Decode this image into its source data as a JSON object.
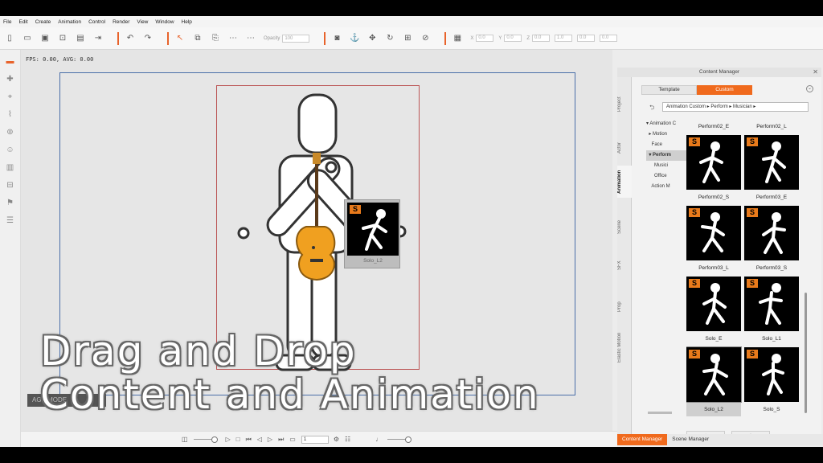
{
  "menu": [
    "File",
    "Edit",
    "Create",
    "Animation",
    "Control",
    "Render",
    "View",
    "Window",
    "Help"
  ],
  "toolbar": {
    "opacity_label": "Opacity",
    "opacity_value": "100",
    "x_label": "X",
    "y_label": "Y",
    "z_label": "Z",
    "x_value": "0.0",
    "y_value": "0.0",
    "z_value": "0.0",
    "scale_value": "1.0"
  },
  "viewport": {
    "fps_text": "FPS: 0.00, AVG: 0.00",
    "stage_mode_label": "AGE MODE"
  },
  "drag_item": {
    "label": "Solo_L2",
    "badge": "S"
  },
  "timeline": {
    "frame_value": "1"
  },
  "side_tabs": [
    "Project",
    "Actor",
    "Animation",
    "Scene",
    "SFX",
    "Prop",
    "Elastic Motion"
  ],
  "active_side_tab": "Animation",
  "content_manager": {
    "title": "Content Manager",
    "close_icon": "✕",
    "tabs": [
      {
        "label": "Template",
        "active": false
      },
      {
        "label": "Custom",
        "active": true
      }
    ],
    "breadcrumb": "Animation Custom ▸ Perform ▸ Musician ▸",
    "tree": [
      {
        "label": "▾ Animation C",
        "selected": false
      },
      {
        "label": "  ▸ Motion",
        "selected": false
      },
      {
        "label": "    Face",
        "selected": false
      },
      {
        "label": "  ▾ Perform",
        "selected": true
      },
      {
        "label": "      Musici",
        "selected": false
      },
      {
        "label": "      Office",
        "selected": false
      },
      {
        "label": "    Action M",
        "selected": false
      }
    ],
    "top_captions": [
      "Perform02_E",
      "Perform02_L"
    ],
    "items": [
      {
        "label": "Perform02_S",
        "badge": "S",
        "selected": false
      },
      {
        "label": "Perform03_E",
        "badge": "S",
        "selected": false
      },
      {
        "label": "Perform03_L",
        "badge": "S",
        "selected": false
      },
      {
        "label": "Perform03_S",
        "badge": "S",
        "selected": false
      },
      {
        "label": "Solo_E",
        "badge": "S",
        "selected": false
      },
      {
        "label": "Solo_L1",
        "badge": "S",
        "selected": false
      },
      {
        "label": "Solo_L2",
        "badge": "S",
        "selected": true
      },
      {
        "label": "Solo_S",
        "badge": "S",
        "selected": false
      }
    ],
    "add_btn": "+",
    "down_btn": "↓"
  },
  "bottom_tabs": [
    {
      "label": "Content Manager",
      "active": true
    },
    {
      "label": "Scene Manager",
      "active": false
    }
  ],
  "caption": {
    "line1": "Drag and Drop",
    "line2": "Content and Animation"
  },
  "colors": {
    "accent": "#f06a1d",
    "badge": "#e87a1b",
    "guitar": "#f0a020"
  }
}
